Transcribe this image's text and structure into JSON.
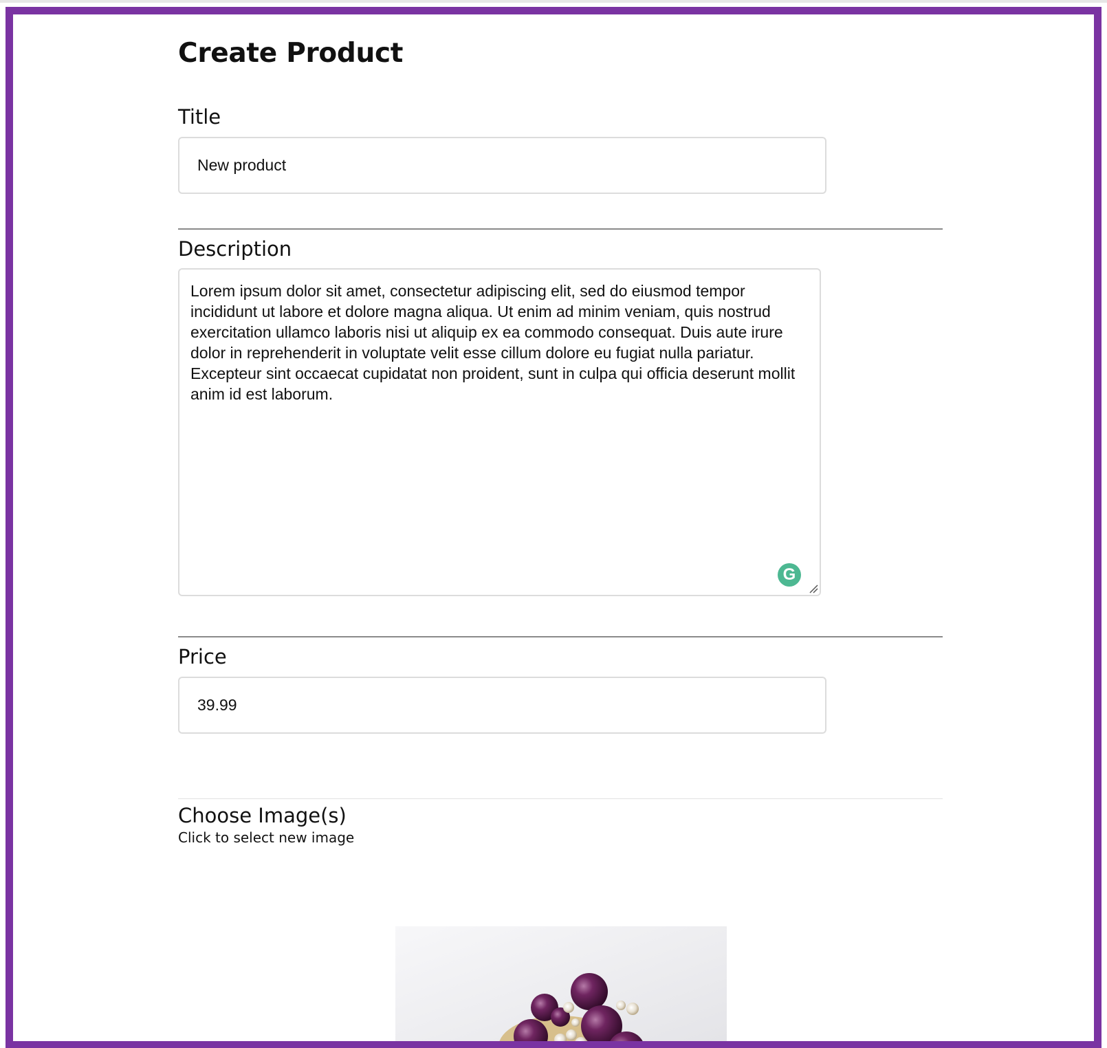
{
  "page": {
    "title": "Create Product"
  },
  "form": {
    "title_label": "Title",
    "title_value": "New product",
    "description_label": "Description",
    "description_value": "Lorem ipsum dolor sit amet, consectetur adipiscing elit, sed do eiusmod tempor incididunt ut labore et dolore magna aliqua. Ut enim ad minim veniam, quis nostrud exercitation ullamco laboris nisi ut aliquip ex ea commodo consequat. Duis aute irure dolor in reprehenderit in voluptate velit esse cillum dolore eu fugiat nulla pariatur. Excepteur sint occaecat cupidatat non proident, sunt in culpa qui officia deserunt mollit anim id est laborum.",
    "price_label": "Price",
    "price_value": "39.99",
    "images_label": "Choose Image(s)",
    "images_hint": "Click to select new image"
  },
  "extensions": {
    "grammarly_icon": "grammarly-icon",
    "grammarly_glyph": "G",
    "grammarly_color": "#4db892"
  },
  "theme": {
    "frame_color": "#7a33a2",
    "jewel_color": "#5a1a46"
  }
}
